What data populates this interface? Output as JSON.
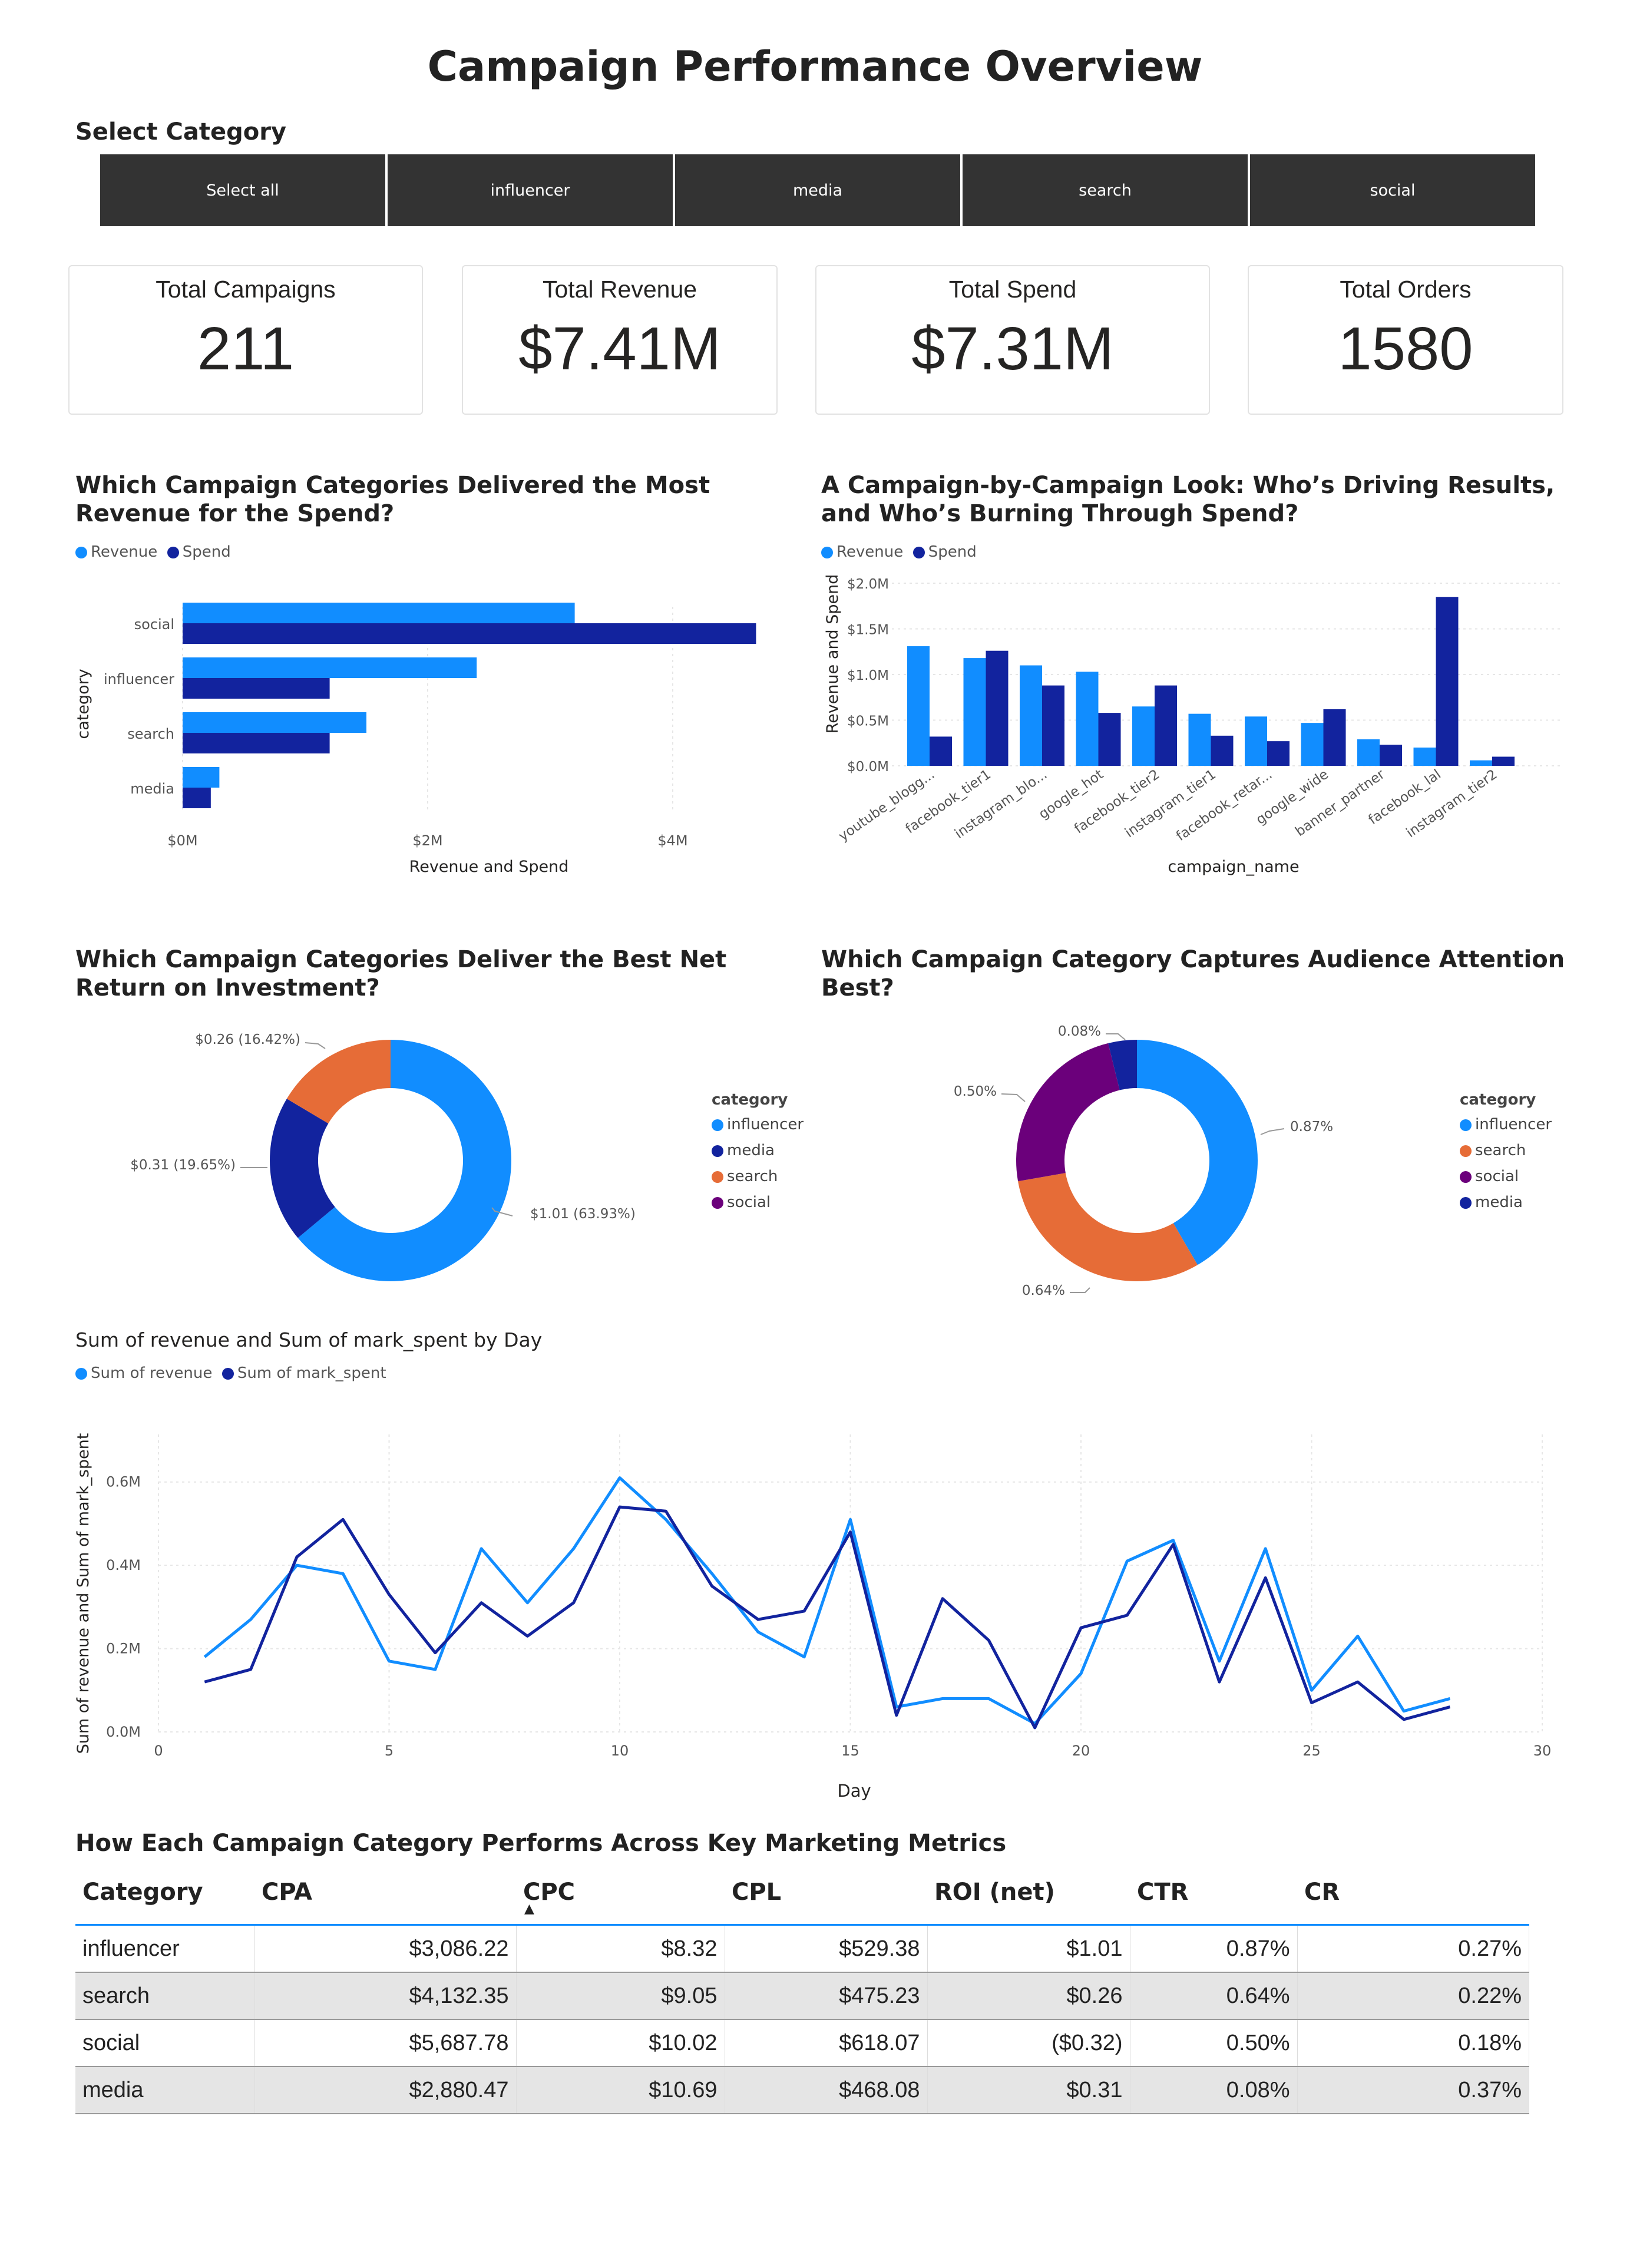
{
  "page": {
    "title": "Campaign Performance Overview"
  },
  "slicer": {
    "heading": "Select Category",
    "options": [
      "Select all",
      "influencer",
      "media",
      "search",
      "social"
    ]
  },
  "kpis": [
    {
      "label": "Total Campaigns",
      "value": "211"
    },
    {
      "label": "Total Revenue",
      "value": "$7.41M"
    },
    {
      "label": "Total Spend",
      "value": "$7.31M"
    },
    {
      "label": "Total Orders",
      "value": "1580"
    }
  ],
  "colors": {
    "revenue": "#118dff",
    "spend": "#12239e",
    "search": "#e66c37",
    "social": "#6b007b",
    "slicer_bg": "#333333",
    "table_header_rule": "#118dff"
  },
  "charts": {
    "category_bar": {
      "title": "Which Campaign Categories Delivered the Most Revenue for the Spend?",
      "legend": [
        "Revenue",
        "Spend"
      ],
      "xlabel": "Revenue and Spend",
      "ylabel": "category",
      "xticks": [
        "$0M",
        "$2M",
        "$4M"
      ]
    },
    "campaign_column": {
      "title": "A Campaign-by-Campaign Look: Who’s Driving Results, and Who’s Burning Through Spend?",
      "legend": [
        "Revenue",
        "Spend"
      ],
      "xlabel": "campaign_name",
      "ylabel": "Revenue and Spend",
      "yticks": [
        "$0.0M",
        "$0.5M",
        "$1.0M",
        "$1.5M",
        "$2.0M"
      ]
    },
    "roi_donut": {
      "title": "Which Campaign Categories Deliver the Best Net Return on Investment?",
      "legend_title": "category",
      "legend": [
        "influencer",
        "media",
        "search",
        "social"
      ],
      "labels": [
        "$1.01 (63.93%)",
        "$0.31 (19.65%)",
        "$0.26 (16.42%)"
      ]
    },
    "ctr_donut": {
      "title": "Which Campaign Category Captures Audience Attention Best?",
      "legend_title": "category",
      "legend": [
        "influencer",
        "search",
        "social",
        "media"
      ],
      "labels": [
        "0.87%",
        "0.64%",
        "0.50%",
        "0.08%"
      ]
    },
    "daily_line": {
      "title": "Sum of revenue and Sum of mark_spent by Day",
      "legend": [
        "Sum of revenue",
        "Sum of mark_spent"
      ],
      "xlabel": "Day",
      "ylabel": "Sum of revenue and Sum of mark_spent",
      "xticks": [
        "0",
        "5",
        "10",
        "15",
        "20",
        "25",
        "30"
      ],
      "yticks": [
        "0.0M",
        "0.2M",
        "0.4M",
        "0.6M"
      ]
    }
  },
  "chart_data": [
    {
      "type": "bar",
      "orientation": "horizontal",
      "categories": [
        "social",
        "influencer",
        "search",
        "media"
      ],
      "series": [
        {
          "name": "Revenue",
          "values": [
            3.2,
            2.4,
            1.5,
            0.3
          ]
        },
        {
          "name": "Spend",
          "values": [
            4.68,
            1.2,
            1.2,
            0.23
          ]
        }
      ],
      "xlim": [
        0,
        5
      ],
      "unit": "$M",
      "legend_position": "top-left",
      "grid": true
    },
    {
      "type": "bar",
      "categories": [
        "youtube_blogg...",
        "facebook_tier1",
        "instagram_blo...",
        "google_hot",
        "facebook_tier2",
        "instagram_tier1",
        "facebook_retar...",
        "google_wide",
        "banner_partner",
        "facebook_lal",
        "instagram_tier2"
      ],
      "series": [
        {
          "name": "Revenue",
          "values": [
            1.31,
            1.18,
            1.1,
            1.03,
            0.65,
            0.57,
            0.54,
            0.47,
            0.29,
            0.2,
            0.06
          ]
        },
        {
          "name": "Spend",
          "values": [
            0.32,
            1.26,
            0.88,
            0.58,
            0.88,
            0.33,
            0.27,
            0.62,
            0.23,
            1.85,
            0.1
          ]
        }
      ],
      "ylim": [
        0,
        2.0
      ],
      "unit": "$M",
      "legend_position": "top-left",
      "grid": true
    },
    {
      "type": "pie",
      "donut": true,
      "categories": [
        "influencer",
        "media",
        "search",
        "social"
      ],
      "values": [
        1.01,
        0.31,
        0.26,
        0
      ],
      "percent": [
        63.93,
        19.65,
        16.42,
        0
      ],
      "legend_position": "right"
    },
    {
      "type": "pie",
      "donut": true,
      "categories": [
        "influencer",
        "search",
        "social",
        "media"
      ],
      "values": [
        0.87,
        0.64,
        0.5,
        0.08
      ],
      "legend_position": "right"
    },
    {
      "type": "line",
      "x": [
        1,
        2,
        3,
        4,
        5,
        6,
        7,
        8,
        9,
        10,
        11,
        12,
        13,
        14,
        15,
        16,
        17,
        18,
        19,
        20,
        21,
        22,
        23,
        24,
        25,
        26,
        27,
        28
      ],
      "series": [
        {
          "name": "Sum of revenue",
          "values": [
            0.18,
            0.27,
            0.4,
            0.38,
            0.17,
            0.15,
            0.44,
            0.31,
            0.44,
            0.61,
            0.51,
            0.38,
            0.24,
            0.18,
            0.51,
            0.06,
            0.08,
            0.08,
            0.02,
            0.14,
            0.41,
            0.46,
            0.17,
            0.44,
            0.1,
            0.23,
            0.05,
            0.08
          ]
        },
        {
          "name": "Sum of mark_spent",
          "values": [
            0.12,
            0.15,
            0.42,
            0.51,
            0.33,
            0.19,
            0.31,
            0.23,
            0.31,
            0.54,
            0.53,
            0.35,
            0.27,
            0.29,
            0.48,
            0.04,
            0.32,
            0.22,
            0.01,
            0.25,
            0.28,
            0.45,
            0.12,
            0.37,
            0.07,
            0.12,
            0.03,
            0.06
          ]
        }
      ],
      "xlim": [
        0,
        30
      ],
      "ylim": [
        0,
        0.7
      ],
      "unit": "M",
      "legend_position": "top-left",
      "grid": true
    },
    {
      "type": "table",
      "columns": [
        "Category",
        "CPA",
        "CPC",
        "CPL",
        "ROI (net)",
        "CTR",
        "CR"
      ],
      "rows": [
        [
          "influencer",
          "$3,086.22",
          "$8.32",
          "$529.38",
          "$1.01",
          "0.87%",
          "0.27%"
        ],
        [
          "search",
          "$4,132.35",
          "$9.05",
          "$475.23",
          "$0.26",
          "0.64%",
          "0.22%"
        ],
        [
          "social",
          "$5,687.78",
          "$10.02",
          "$618.07",
          "($0.32)",
          "0.50%",
          "0.18%"
        ],
        [
          "media",
          "$2,880.47",
          "$10.69",
          "$468.08",
          "$0.31",
          "0.08%",
          "0.37%"
        ]
      ]
    }
  ],
  "table": {
    "title": "How Each Campaign Category Performs Across Key Marketing Metrics",
    "sort_column": "CPC"
  }
}
